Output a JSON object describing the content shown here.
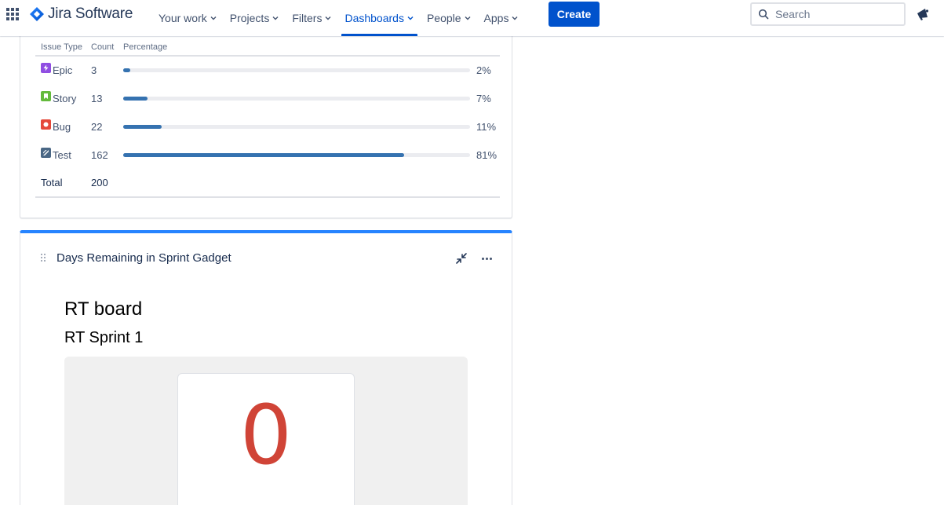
{
  "nav": {
    "app_switcher_icon": "grid-icon",
    "product_name": "Jira Software",
    "items": [
      {
        "label": "Your work",
        "active": false
      },
      {
        "label": "Projects",
        "active": false
      },
      {
        "label": "Filters",
        "active": false
      },
      {
        "label": "Dashboards",
        "active": true
      },
      {
        "label": "People",
        "active": false
      },
      {
        "label": "Apps",
        "active": false
      }
    ],
    "create_label": "Create",
    "search_placeholder": "Search",
    "notification_icon": "megaphone-icon",
    "accent_color": "#0052cc"
  },
  "issue_stats": {
    "headers": {
      "type": "Issue Type",
      "count": "Count",
      "percentage": "Percentage"
    },
    "rows": [
      {
        "type": "Epic",
        "count": "3",
        "percent": "2%",
        "fraction": 0.02,
        "icon": "epic-icon",
        "icon_color": "#904ee2"
      },
      {
        "type": "Story",
        "count": "13",
        "percent": "7%",
        "fraction": 0.07,
        "icon": "story-icon",
        "icon_color": "#63ba3c"
      },
      {
        "type": "Bug",
        "count": "22",
        "percent": "11%",
        "fraction": 0.11,
        "icon": "bug-icon",
        "icon_color": "#e5493a"
      },
      {
        "type": "Test",
        "count": "162",
        "percent": "81%",
        "fraction": 0.81,
        "icon": "test-icon",
        "icon_color": "#4a6785"
      }
    ],
    "total_label": "Total",
    "total_count": "200",
    "bar_color": "#3572b0"
  },
  "days_gadget": {
    "title": "Days Remaining in Sprint Gadget",
    "board": "RT board",
    "sprint": "RT Sprint 1",
    "days_remaining": "0",
    "days_color": "#d04437",
    "header_accent": "#2684ff"
  }
}
